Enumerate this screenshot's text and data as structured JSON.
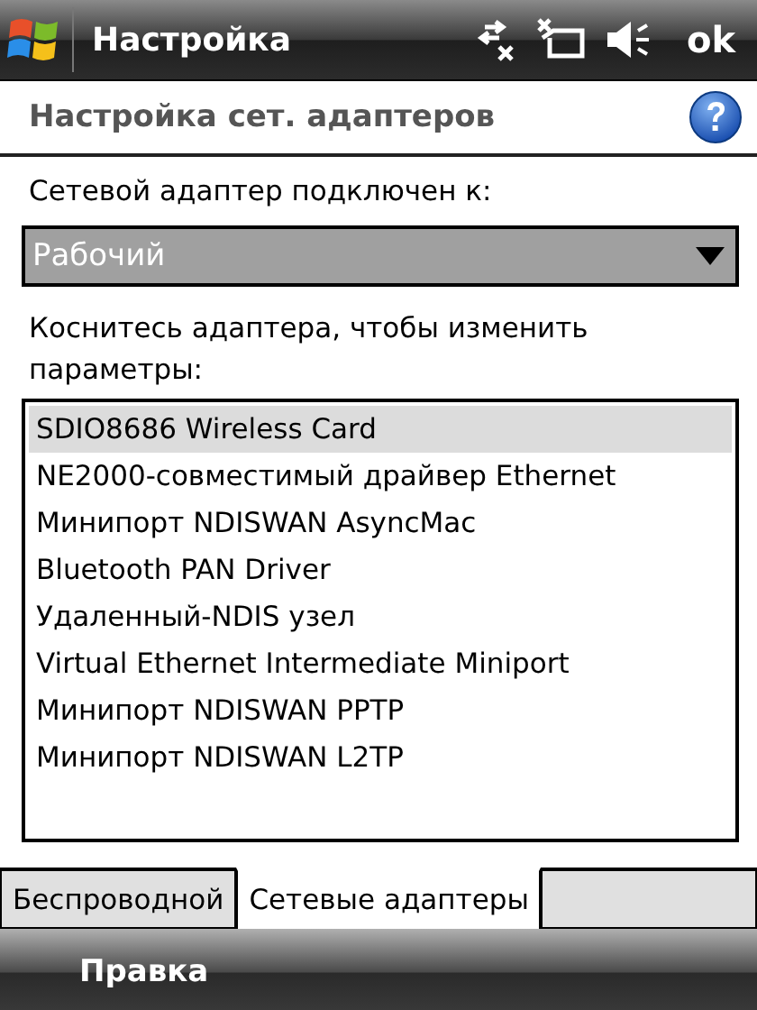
{
  "title_bar": {
    "title": "Настройка",
    "ok": "ok"
  },
  "header": {
    "title": "Настройка сет. адаптеров"
  },
  "connect_label": "Сетевой адаптер подключен к:",
  "network_dropdown": {
    "value": "Рабочий"
  },
  "hint": "Коснитесь адаптера, чтобы изменить параметры:",
  "adapters": [
    {
      "label": "SDIO8686 Wireless Card",
      "selected": true
    },
    {
      "label": "NE2000-совместимый драйвер Ethernet",
      "selected": false
    },
    {
      "label": "Минипорт NDISWAN AsyncMac",
      "selected": false
    },
    {
      "label": "Bluetooth PAN Driver",
      "selected": false
    },
    {
      "label": "Удаленный-NDIS узел",
      "selected": false
    },
    {
      "label": "Virtual Ethernet Intermediate Miniport",
      "selected": false
    },
    {
      "label": "Минипорт NDISWAN PPTP",
      "selected": false
    },
    {
      "label": "Минипорт NDISWAN L2TP",
      "selected": false
    }
  ],
  "tabs": [
    {
      "label": "Беспроводной",
      "selected": false
    },
    {
      "label": "Сетевые адаптеры",
      "selected": true
    }
  ],
  "softkeys": {
    "left": "Правка"
  }
}
